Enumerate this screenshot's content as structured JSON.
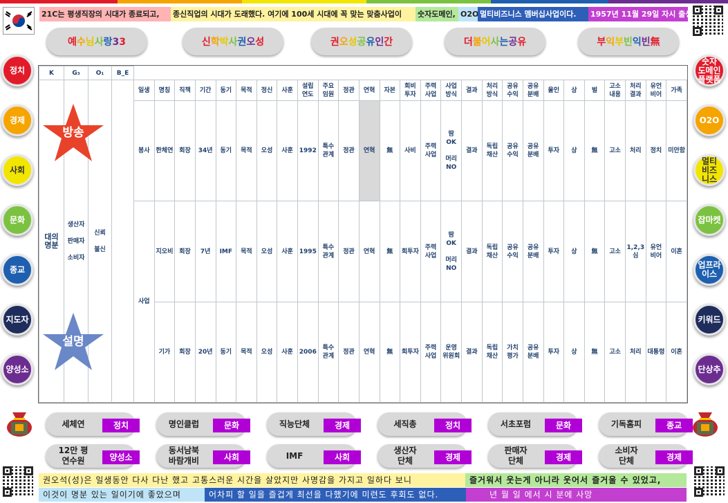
{
  "header": {
    "segments": [
      {
        "text": "21C는 평생직장의 시대가 종료되고,",
        "bg": "#ffb3b3"
      },
      {
        "text": "종신직업의 시대가 도래했다. 여기에 100세 시대에 꼭 맞는 맞춤사업이",
        "bg": "#fff3a0"
      },
      {
        "text": "숫자도메인,",
        "bg": "#b4e89a"
      },
      {
        "text": "O2O,",
        "bg": "#bfe4f7"
      },
      {
        "text": "멀티비즈니스 멤버십사업이다.",
        "bg": "#2e5fb8"
      },
      {
        "text": "1957년 11월 29일 자시 출생",
        "bg": "#c23fd0"
      }
    ]
  },
  "slogans": [
    "예수님사랑33",
    "신학박사권오성",
    "권오성공유인간",
    "더불어사는공유",
    "부익부빈익빈無"
  ],
  "left_circles": [
    {
      "label": "정치",
      "color": "#e21b2b"
    },
    {
      "label": "경제",
      "color": "#f5a400"
    },
    {
      "label": "사회",
      "color": "#f2e600"
    },
    {
      "label": "문화",
      "color": "#7cc242"
    },
    {
      "label": "종교",
      "color": "#1e5fb0"
    },
    {
      "label": "지도자",
      "color": "#1f2d5c"
    },
    {
      "label": "양성소",
      "color": "#6c2d91"
    }
  ],
  "right_circles": [
    {
      "label": "숫자\n도메인\n플랫폼",
      "color": "#e21b2b"
    },
    {
      "label": "O2O",
      "color": "#f5a400"
    },
    {
      "label": "멀티\n비즈\n니스",
      "color": "#f2e600"
    },
    {
      "label": "잡마켓",
      "color": "#7cc242"
    },
    {
      "label": "업프라\n이스",
      "color": "#1e5fb0"
    },
    {
      "label": "키워드",
      "color": "#1f2d5c"
    },
    {
      "label": "단상추",
      "color": "#6c2d91"
    }
  ],
  "table": {
    "left_headers": [
      "K",
      "G₃",
      "O₁",
      "B_E"
    ],
    "col_headers": [
      "일생",
      "명칭",
      "직책",
      "기간",
      "동기",
      "목적",
      "정신",
      "사훈",
      "설립\n연도",
      "주요\n임원",
      "정관",
      "연혁",
      "자본",
      "회비\n투자",
      "주력\n사업",
      "사업\n방식",
      "결과",
      "처리\n방식",
      "공유\n수익",
      "공유\n분배",
      "울인",
      "상",
      "벌",
      "고소\n내용",
      "처리\n결과",
      "유언\n비어",
      "가족"
    ],
    "k_label": "대의\n명분",
    "g_label": "생산자\n\n판매자\n\n소비자",
    "o_label": "신뢰\n\n불신",
    "star_top": "방송",
    "star_bottom": "설명",
    "life_col": [
      "봉사",
      "사업"
    ],
    "rows": [
      [
        "한체연",
        "회장",
        "34년",
        "동기",
        "목적",
        "오성",
        "사훈",
        "1992",
        "특수\n관계",
        "정관",
        "연혁",
        "無",
        "사비",
        "주력\n사업",
        "땀\nOK\n\n머리\nNO",
        "결과",
        "독립\n채산",
        "공유\n수익",
        "공유\n분배",
        "투자",
        "상",
        "無",
        "고소",
        "처리",
        "정치",
        "미안함"
      ],
      [
        "지오비",
        "회장",
        "7년",
        "IMF",
        "목적",
        "오성",
        "사훈",
        "1995",
        "특수\n관계",
        "정관",
        "연혁",
        "無",
        "회투자",
        "주력\n사업",
        "땀\nOK\n\n머리\nNO",
        "결과",
        "독립\n채산",
        "공유\n수익",
        "공유\n분배",
        "투자",
        "상",
        "無",
        "고소",
        "1,2,3심",
        "유언\n비어",
        "이혼"
      ],
      [
        "기가",
        "회장",
        "20년",
        "동기",
        "목적",
        "오성",
        "사훈",
        "2006",
        "특수\n관계",
        "정관",
        "연혁",
        "無",
        "회투자",
        "주력\n사업",
        "운영\n위원회",
        "결과",
        "독립\n채산",
        "가치\n평가",
        "공유\n분배",
        "투자",
        "상",
        "無",
        "고소",
        "처리",
        "대통령",
        "이혼"
      ]
    ]
  },
  "orgs_row1": [
    {
      "name": "세체연",
      "tag": "정치"
    },
    {
      "name": "명인클럽",
      "tag": "문화"
    },
    {
      "name": "직능단체",
      "tag": "경제"
    },
    {
      "name": "세직총",
      "tag": "정치"
    },
    {
      "name": "서초포럼",
      "tag": "문화"
    },
    {
      "name": "기독홈피",
      "tag": "종교"
    }
  ],
  "orgs_row2": [
    {
      "name": "12만 평\n연수원",
      "tag": "양성소"
    },
    {
      "name": "동서남북\n바람개비",
      "tag": "사회"
    },
    {
      "name": "IMF",
      "tag": "사회"
    },
    {
      "name": "생산자\n단체",
      "tag": "경제"
    },
    {
      "name": "판매자\n단체",
      "tag": "경제"
    },
    {
      "name": "소비자\n단체",
      "tag": "경제"
    }
  ],
  "footer": {
    "line1a": "권오석(성)은 일생동안 다사 다난 했고 고통스러운 시간을 살았지만 사명감을 가지고 일하다 보니",
    "line1b": "즐거워서 웃는게 아니라 웃어서 즐거울 수 있었고,",
    "line2a": "이것이 명분 있는 일이기에 좋았으며",
    "line2b": "어차피 할 일을 즐겁게 최선을 다했기에 미련도 후회도 없다.",
    "line2c": "년    월    일         에서    시    분에 사망"
  }
}
